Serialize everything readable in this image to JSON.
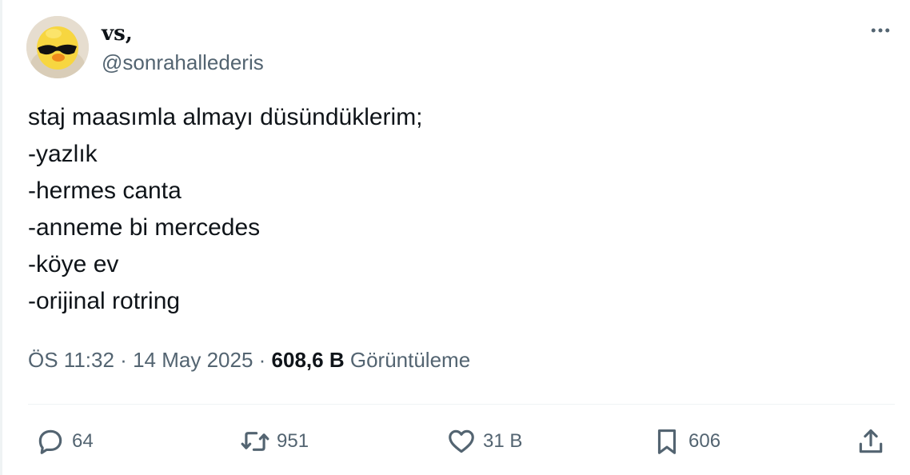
{
  "author": {
    "display_name": "vs,",
    "handle": "@sonrahallederis"
  },
  "tweet": {
    "lines": [
      "staj maasımla almayı düsündüklerim;",
      "-yazlık",
      "-hermes canta",
      "-anneme bi mercedes",
      "-köye ev",
      "-orijinal rotring"
    ]
  },
  "meta": {
    "time": "ÖS 11:32",
    "separator": "·",
    "date": "14 May 2025",
    "views_count": "608,6 B",
    "views_label": "Görüntüleme"
  },
  "actions": {
    "reply_count": "64",
    "retweet_count": "951",
    "like_count": "31 B",
    "bookmark_count": "606"
  },
  "icons": {
    "more": "more-horizontal-icon",
    "reply": "speech-bubble-icon",
    "retweet": "retweet-arrows-icon",
    "like": "heart-icon",
    "bookmark": "bookmark-icon",
    "share": "share-upload-icon"
  },
  "colors": {
    "text_primary": "#0f1419",
    "text_secondary": "#536471",
    "divider": "#eff3f4"
  }
}
